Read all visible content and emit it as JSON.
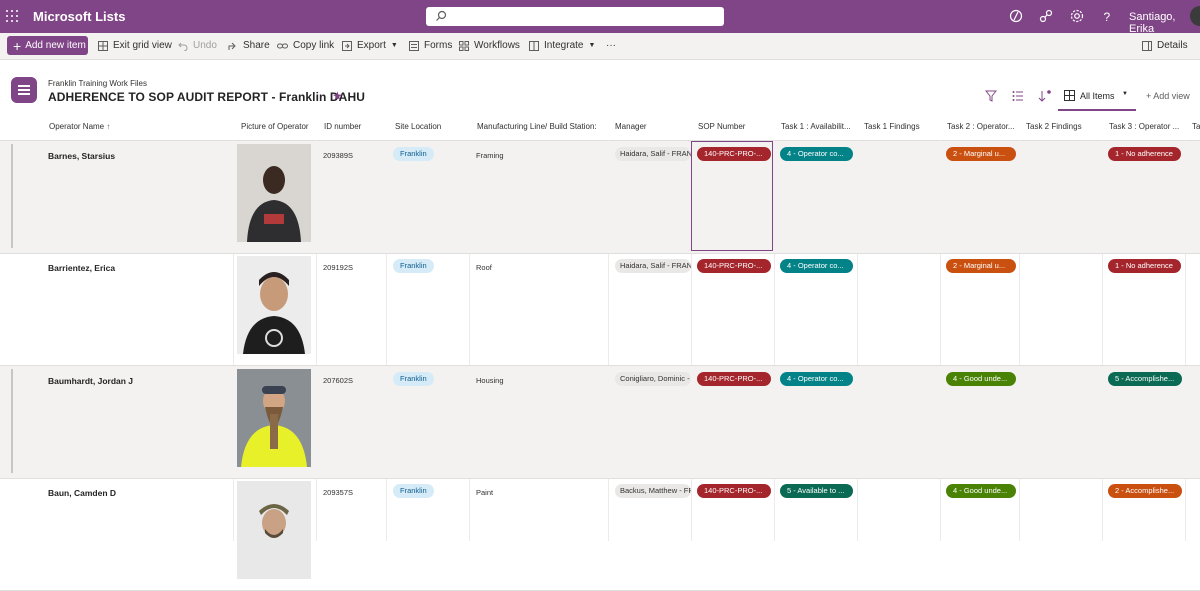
{
  "app": {
    "name": "Microsoft Lists",
    "user": "Santiago, Erika"
  },
  "toolbar": {
    "new_item": "Add new item",
    "exit_grid": "Exit grid view",
    "undo": "Undo",
    "share": "Share",
    "copy_link": "Copy link",
    "export": "Export",
    "forms": "Forms",
    "workflows": "Workflows",
    "integrate": "Integrate",
    "more": "···",
    "details": "Details"
  },
  "header": {
    "site": "Franklin Training Work Files",
    "title": "ADHERENCE TO SOP AUDIT REPORT - Franklin DAHU",
    "view": "All Items",
    "add_view": "+ Add view"
  },
  "columns": {
    "operator": "Operator Name",
    "sort": "↑",
    "picture": "Picture of Operator",
    "id": "ID number",
    "site": "Site Location",
    "line": "Manufacturing Line/ Build Station:",
    "manager": "Manager",
    "sop": "SOP Number",
    "task1": "Task 1 : Availabilit...",
    "task1f": "Task 1 Findings",
    "task2": "Task 2 : Operator...",
    "task2f": "Task 2 Findings",
    "task3": "Task 3 : Operator ...",
    "task3b": "Ta"
  },
  "rows": [
    {
      "name": "Barnes, Starsius",
      "id": "209389S",
      "site": "Franklin",
      "line": "Framing",
      "manager": "Haidara, Salif - FRANK",
      "sop": "140-PRC-PRO-...",
      "task1": "4 - Operator co...",
      "task2": "2 - Marginal u...",
      "task3": "1 - No adherence"
    },
    {
      "name": "Barrientez, Erica",
      "id": "209192S",
      "site": "Franklin",
      "line": "Roof",
      "manager": "Haidara, Salif - FRANK",
      "sop": "140-PRC-PRO-...",
      "task1": "4 - Operator co...",
      "task2": "2 - Marginal u...",
      "task3": "1 - No adherence"
    },
    {
      "name": "Baumhardt, Jordan J",
      "id": "207602S",
      "site": "Franklin",
      "line": "Housing",
      "manager": "Conigliaro, Dominic -",
      "sop": "140-PRC-PRO-...",
      "task1": "4 - Operator co...",
      "task2": "4 - Good unde...",
      "task3": "5 - Accomplishe..."
    },
    {
      "name": "Baun, Camden D",
      "id": "209357S",
      "site": "Franklin",
      "line": "Paint",
      "manager": "Backus, Matthew - FR",
      "sop": "140-PRC-PRO-...",
      "task1": "5 - Available to ...",
      "task2": "4 - Good unde...",
      "task3": "2 - Accomplishe..."
    }
  ],
  "colors": {
    "brand": "#804587",
    "sop": "#a4262c",
    "teal": "#038387",
    "darkgreen": "#0b6a53",
    "orange": "#ca5010",
    "green": "#498205"
  }
}
